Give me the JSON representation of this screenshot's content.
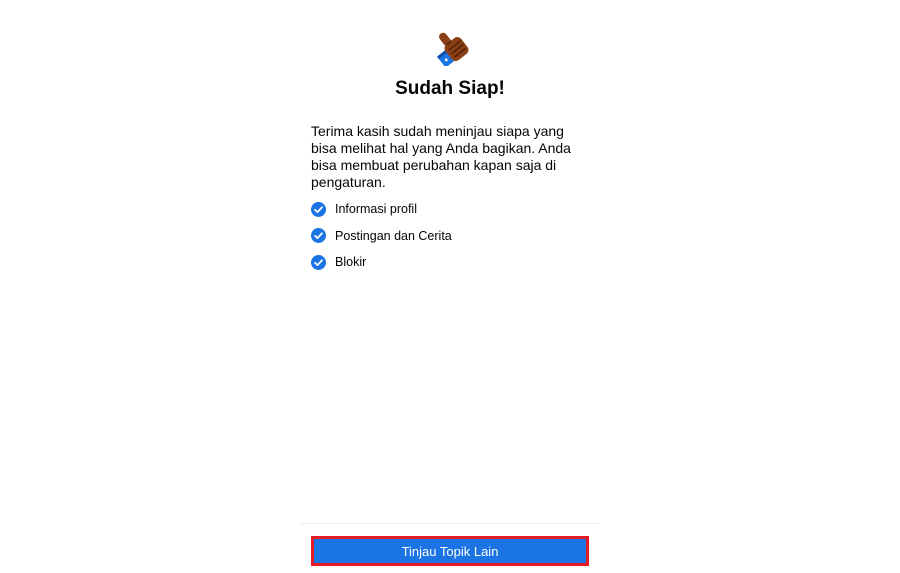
{
  "header": {
    "icon": "thumbs-up-icon",
    "title": "Sudah Siap!"
  },
  "description": "Terima kasih sudah meninjau siapa yang bisa melihat hal yang Anda bagikan. Anda bisa membuat perubahan kapan saja di pengaturan.",
  "reviewed_items": [
    {
      "label": "Informasi profil",
      "icon": "check-circle-icon"
    },
    {
      "label": "Postingan dan Cerita",
      "icon": "check-circle-icon"
    },
    {
      "label": "Blokir",
      "icon": "check-circle-icon"
    }
  ],
  "footer": {
    "button_label": "Tinjau Topik Lain"
  },
  "colors": {
    "accent": "#1b74e4",
    "highlight_border": "#e41b23",
    "check": "#1b74e4"
  }
}
